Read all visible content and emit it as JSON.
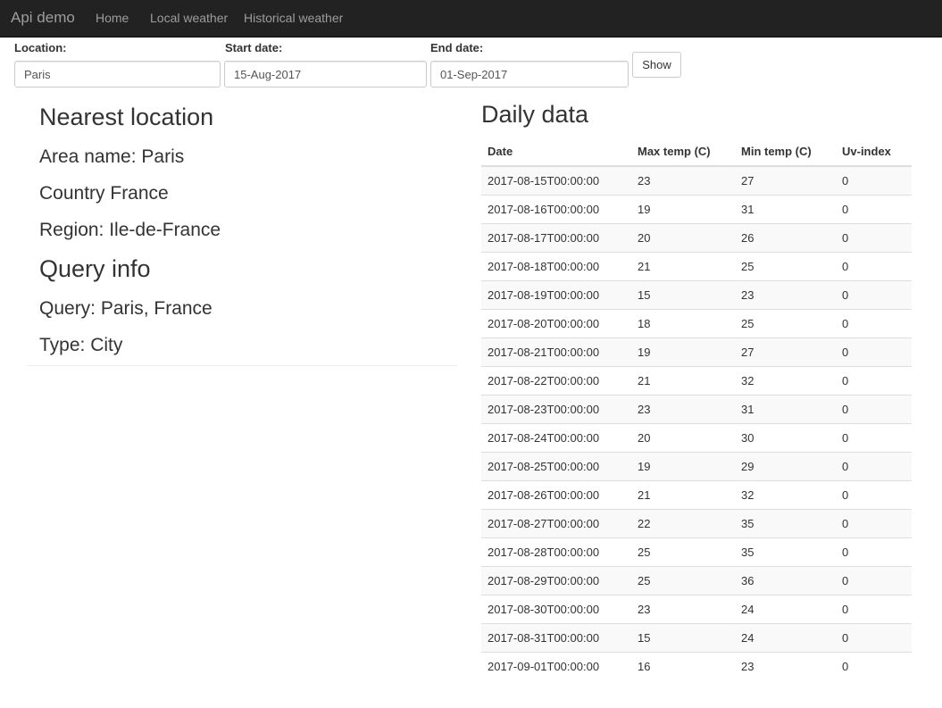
{
  "navbar": {
    "brand": "Api demo",
    "links": [
      "Home",
      "Local weather",
      "Historical weather"
    ]
  },
  "form": {
    "location_label": "Location:",
    "location_value": "Paris",
    "start_label": "Start date:",
    "start_value": "15-Aug-2017",
    "end_label": "End date:",
    "end_value": "01-Sep-2017",
    "show_label": "Show"
  },
  "nearest": {
    "title": "Nearest location",
    "area": "Area name: Paris",
    "country": "Country France",
    "region": "Region: Ile-de-France"
  },
  "query": {
    "title": "Query info",
    "query": "Query: Paris, France",
    "type": "Type: City"
  },
  "daily": {
    "title": "Daily data",
    "headers": [
      "Date",
      "Max temp (C)",
      "Min temp (C)",
      "Uv-index"
    ],
    "rows": [
      [
        "2017-08-15T00:00:00",
        "23",
        "27",
        "0"
      ],
      [
        "2017-08-16T00:00:00",
        "19",
        "31",
        "0"
      ],
      [
        "2017-08-17T00:00:00",
        "20",
        "26",
        "0"
      ],
      [
        "2017-08-18T00:00:00",
        "21",
        "25",
        "0"
      ],
      [
        "2017-08-19T00:00:00",
        "15",
        "23",
        "0"
      ],
      [
        "2017-08-20T00:00:00",
        "18",
        "25",
        "0"
      ],
      [
        "2017-08-21T00:00:00",
        "19",
        "27",
        "0"
      ],
      [
        "2017-08-22T00:00:00",
        "21",
        "32",
        "0"
      ],
      [
        "2017-08-23T00:00:00",
        "23",
        "31",
        "0"
      ],
      [
        "2017-08-24T00:00:00",
        "20",
        "30",
        "0"
      ],
      [
        "2017-08-25T00:00:00",
        "19",
        "29",
        "0"
      ],
      [
        "2017-08-26T00:00:00",
        "21",
        "32",
        "0"
      ],
      [
        "2017-08-27T00:00:00",
        "22",
        "35",
        "0"
      ],
      [
        "2017-08-28T00:00:00",
        "25",
        "35",
        "0"
      ],
      [
        "2017-08-29T00:00:00",
        "25",
        "36",
        "0"
      ],
      [
        "2017-08-30T00:00:00",
        "23",
        "24",
        "0"
      ],
      [
        "2017-08-31T00:00:00",
        "15",
        "24",
        "0"
      ],
      [
        "2017-09-01T00:00:00",
        "16",
        "23",
        "0"
      ]
    ]
  },
  "colors": {
    "navbar_bg": "#222222",
    "nav_text": "#9d9d9d",
    "stripe": "#f9f9f9",
    "border": "#dddddd"
  }
}
